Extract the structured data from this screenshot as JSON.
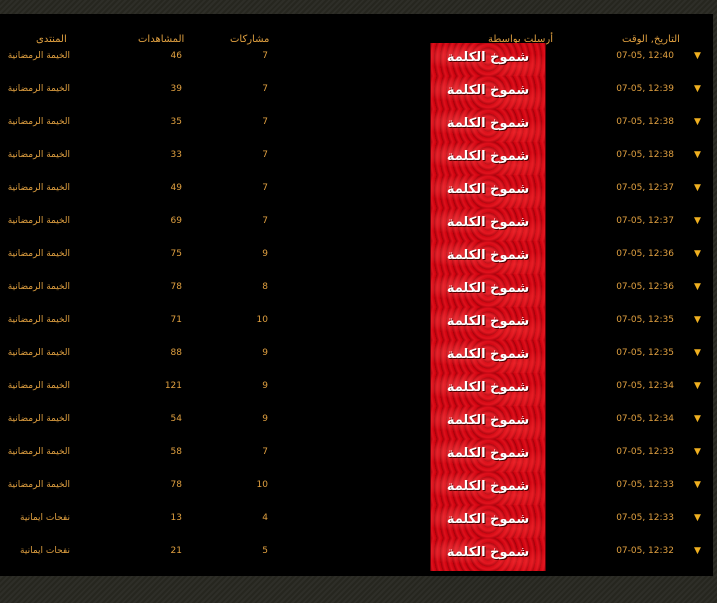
{
  "headers": {
    "time": "التاريخ, الوقت",
    "sender": "أرسلت بواسطة",
    "posts": "مشاركات",
    "views": "المشاهدات",
    "forum": "المنتدى"
  },
  "sender_image_text": "شموخ الكلمة",
  "rows": [
    {
      "time": "07-05, 12:40",
      "posts": "7",
      "views": "46",
      "forum": "الخيمة الرمضانية"
    },
    {
      "time": "07-05, 12:39",
      "posts": "7",
      "views": "39",
      "forum": "الخيمة الرمضانية"
    },
    {
      "time": "07-05, 12:38",
      "posts": "7",
      "views": "35",
      "forum": "الخيمة الرمضانية"
    },
    {
      "time": "07-05, 12:38",
      "posts": "7",
      "views": "33",
      "forum": "الخيمة الرمضانية"
    },
    {
      "time": "07-05, 12:37",
      "posts": "7",
      "views": "49",
      "forum": "الخيمة الرمضانية"
    },
    {
      "time": "07-05, 12:37",
      "posts": "7",
      "views": "69",
      "forum": "الخيمة الرمضانية"
    },
    {
      "time": "07-05, 12:36",
      "posts": "9",
      "views": "75",
      "forum": "الخيمة الرمضانية"
    },
    {
      "time": "07-05, 12:36",
      "posts": "8",
      "views": "78",
      "forum": "الخيمة الرمضانية"
    },
    {
      "time": "07-05, 12:35",
      "posts": "10",
      "views": "71",
      "forum": "الخيمة الرمضانية"
    },
    {
      "time": "07-05, 12:35",
      "posts": "9",
      "views": "88",
      "forum": "الخيمة الرمضانية"
    },
    {
      "time": "07-05, 12:34",
      "posts": "9",
      "views": "121",
      "forum": "الخيمة الرمضانية"
    },
    {
      "time": "07-05, 12:34",
      "posts": "9",
      "views": "54",
      "forum": "الخيمة الرمضانية"
    },
    {
      "time": "07-05, 12:33",
      "posts": "7",
      "views": "58",
      "forum": "الخيمة الرمضانية"
    },
    {
      "time": "07-05, 12:33",
      "posts": "10",
      "views": "78",
      "forum": "الخيمة الرمضانية"
    },
    {
      "time": "07-05, 12:33",
      "posts": "4",
      "views": "13",
      "forum": "نفحات ايمانية"
    },
    {
      "time": "07-05, 12:32",
      "posts": "5",
      "views": "21",
      "forum": "نفحات ايمانية"
    }
  ],
  "icons": {
    "row_arrow": "triangle-down-icon"
  },
  "colors": {
    "text": "#e0a040",
    "background": "#000000",
    "sender_bg": "#d0000c"
  }
}
